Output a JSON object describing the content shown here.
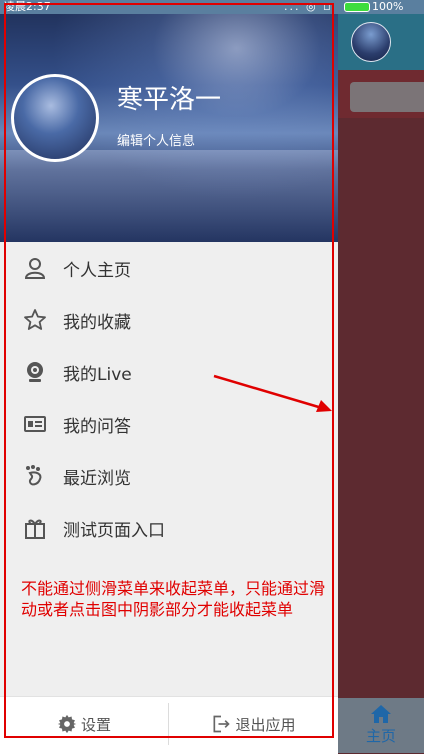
{
  "status_bar": {
    "time": "凌晨2:37",
    "signal_icons": "... ◎ ▫",
    "battery": "100%"
  },
  "profile": {
    "name": "寒平洛一",
    "edit_link": "编辑个人信息"
  },
  "menu": [
    {
      "label": "个人主页",
      "icon": "person-icon"
    },
    {
      "label": "我的收藏",
      "icon": "star-icon"
    },
    {
      "label": "我的Live",
      "icon": "webcam-icon"
    },
    {
      "label": "我的问答",
      "icon": "id-card-icon"
    },
    {
      "label": "最近浏览",
      "icon": "footprint-icon"
    },
    {
      "label": "测试页面入口",
      "icon": "gift-icon"
    }
  ],
  "annotation": "不能通过侧滑菜单来收起菜单，只能通过滑动或者点击图中阴影部分才能收起菜单",
  "bottom_bar": {
    "settings_label": "设置",
    "exit_label": "退出应用"
  },
  "behind": {
    "tab_label": "主页"
  },
  "colors": {
    "annotation_red": "#e00000",
    "overlay": "#5d2a30",
    "home_blue": "#1f67a8"
  }
}
